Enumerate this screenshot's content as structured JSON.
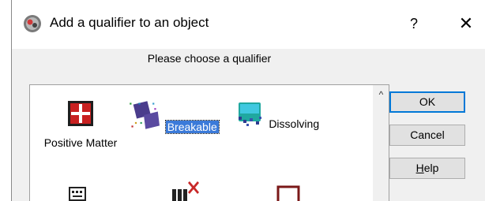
{
  "window": {
    "title": "Add a qualifier to an object",
    "help_label": "?",
    "close_label": "✕"
  },
  "prompt": "Please choose a qualifier",
  "qualifiers": [
    {
      "label": "Positive Matter",
      "selected": false
    },
    {
      "label": "Breakable",
      "selected": true
    },
    {
      "label": "Dissolving",
      "selected": false
    }
  ],
  "scroll_up_glyph": "^",
  "buttons": {
    "ok": "OK",
    "cancel": "Cancel",
    "help_rest": "elp",
    "help_mnemonic": "H"
  },
  "colors": {
    "selection": "#3b7ad9",
    "default_button_border": "#0078d7"
  }
}
